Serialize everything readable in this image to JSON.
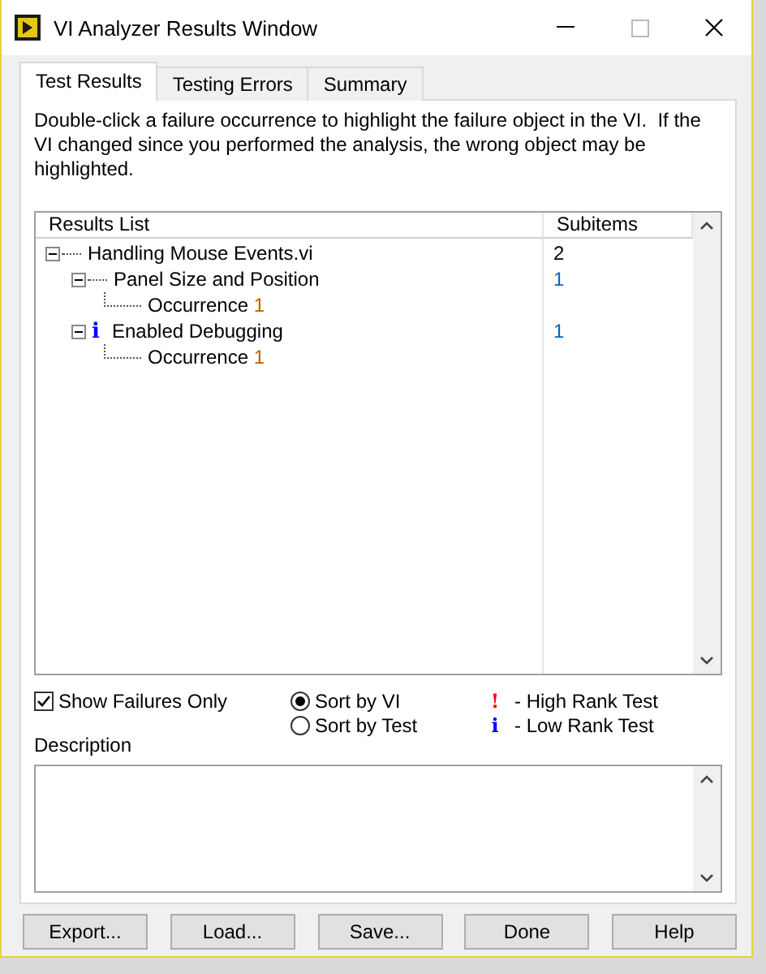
{
  "window": {
    "title": "VI Analyzer Results Window"
  },
  "tabs": [
    {
      "label": "Test Results",
      "selected": true
    },
    {
      "label": "Testing Errors",
      "selected": false
    },
    {
      "label": "Summary",
      "selected": false
    }
  ],
  "instructions": "Double-click a failure occurrence to highlight the failure object in the VI.  If the VI changed since you performed the analysis, the wrong object may be highlighted.",
  "results": {
    "columns": [
      "Results List",
      "Subitems"
    ],
    "rows": [
      {
        "name": "Handling Mouse Events.vi",
        "subitems": "2",
        "expanded": true,
        "children": [
          {
            "name": "Panel Size and Position",
            "subitems": "1",
            "expanded": true,
            "children": [
              {
                "name": "Occurrence",
                "index": "1"
              }
            ]
          },
          {
            "name": "Enabled Debugging",
            "subitems": "1",
            "expanded": true,
            "rank_symbol": "i",
            "children": [
              {
                "name": "Occurrence",
                "index": "1"
              }
            ]
          }
        ]
      }
    ]
  },
  "show_failures_only": {
    "label": "Show Failures Only",
    "checked": true
  },
  "sort_options": [
    {
      "label": "Sort by VI",
      "selected": true
    },
    {
      "label": "Sort by Test",
      "selected": false
    }
  ],
  "legend": [
    {
      "symbol": "!",
      "color": "#ff0000",
      "label": "- High Rank Test"
    },
    {
      "symbol": "i",
      "color": "#0000ff",
      "label": "- Low Rank Test"
    }
  ],
  "description": {
    "label": "Description"
  },
  "buttons": [
    "Export...",
    "Load...",
    "Save...",
    "Done",
    "Help"
  ]
}
